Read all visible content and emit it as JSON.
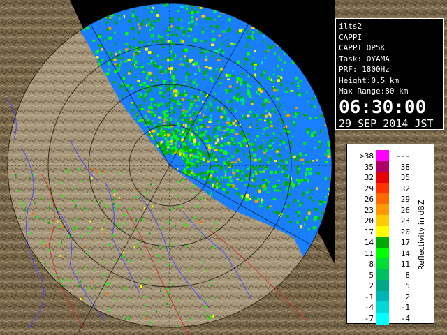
{
  "info": {
    "radar": "ilts2",
    "product": "CAPPI",
    "product_code": "CAPPI_OP5K",
    "task": "Task: OYAMA",
    "prf": "PRF: 1800Hz",
    "height": "Height:0.5 km",
    "max_range": "Max Range:80 km",
    "time": "06:30:00",
    "date": "29 SEP 2014 JST"
  },
  "legend": {
    "title": "Reflectivity in dBZ",
    "rows": [
      {
        "lo": ">38",
        "hi": "---",
        "color": "#ff00ff"
      },
      {
        "lo": "35",
        "hi": "38",
        "color": "#b0006a"
      },
      {
        "lo": "32",
        "hi": "35",
        "color": "#e60000"
      },
      {
        "lo": "29",
        "hi": "32",
        "color": "#ff3300"
      },
      {
        "lo": "26",
        "hi": "29",
        "color": "#ff6a00"
      },
      {
        "lo": "23",
        "hi": "26",
        "color": "#ff9900"
      },
      {
        "lo": "20",
        "hi": "23",
        "color": "#ffcc00"
      },
      {
        "lo": "17",
        "hi": "20",
        "color": "#ffff00"
      },
      {
        "lo": "14",
        "hi": "17",
        "color": "#00aa00"
      },
      {
        "lo": "11",
        "hi": "14",
        "color": "#00ff00"
      },
      {
        "lo": "8",
        "hi": "11",
        "color": "#00dd33"
      },
      {
        "lo": "5",
        "hi": "8",
        "color": "#00c060"
      },
      {
        "lo": "2",
        "hi": "5",
        "color": "#00a888"
      },
      {
        "lo": "-1",
        "hi": "2",
        "color": "#00b5b5"
      },
      {
        "lo": "-4",
        "hi": "-1",
        "color": "#00d8d8"
      },
      {
        "lo": "-7",
        "hi": "-4",
        "color": "#00ffff"
      }
    ]
  },
  "colors": {
    "no_echo": "#1a7fff",
    "land_light": "#9e8e6e",
    "land_dark": "#6b5a40",
    "grid": "#000000",
    "river": "#4a4aff",
    "border": "#cc3030"
  }
}
